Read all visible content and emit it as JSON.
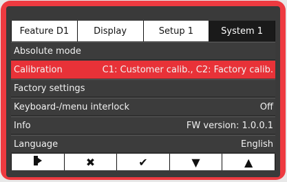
{
  "tabs": [
    "Feature  D1",
    "Display",
    "Setup 1",
    "System 1"
  ],
  "active_tab": "System 1",
  "rows": [
    {
      "label": "Absolute mode",
      "value": ""
    },
    {
      "label": "Calibration",
      "value": "C1: Customer calib., C2: Factory calib."
    },
    {
      "label": "Factory settings",
      "value": ""
    },
    {
      "label": "Keyboard-/menu interlock",
      "value": "Off"
    },
    {
      "label": "Info",
      "value": "FW version: 1.0.0.1"
    },
    {
      "label": "Language",
      "value": "English"
    }
  ],
  "selected_row": "Calibration",
  "softkeys": [
    {
      "icon": "exit-icon",
      "glyph": "⇥"
    },
    {
      "icon": "cancel-icon",
      "glyph": "✖"
    },
    {
      "icon": "confirm-icon",
      "glyph": "✔"
    },
    {
      "icon": "arrow-down-icon",
      "glyph": "▼"
    },
    {
      "icon": "arrow-up-icon",
      "glyph": "▲"
    }
  ],
  "colors": {
    "accent": "#e83238",
    "screen": "#3a3a3a",
    "bezel": "#ee3a40"
  }
}
